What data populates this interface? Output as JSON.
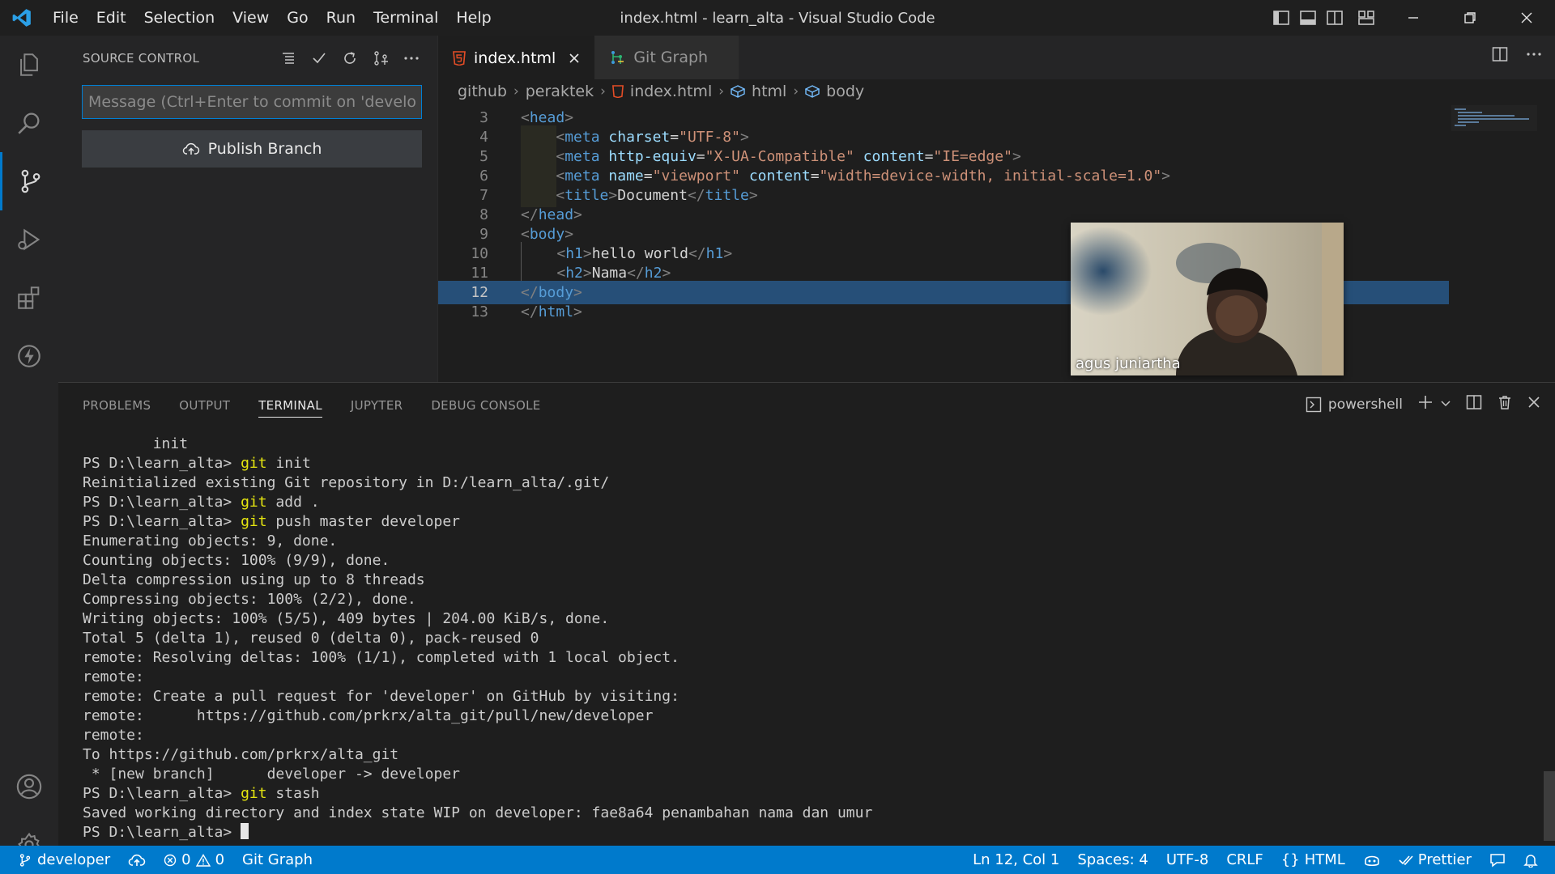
{
  "titlebar": {
    "menu": [
      "File",
      "Edit",
      "Selection",
      "View",
      "Go",
      "Run",
      "Terminal",
      "Help"
    ],
    "title": "index.html - learn_alta - Visual Studio Code"
  },
  "sidebar": {
    "title": "SOURCE CONTROL",
    "message_placeholder": "Message (Ctrl+Enter to commit on 'developer')",
    "publish_label": "Publish Branch"
  },
  "tabs": [
    {
      "label": "index.html",
      "active": true
    },
    {
      "label": "Git Graph",
      "active": false
    }
  ],
  "breadcrumb": [
    "github",
    "peraktek",
    "index.html",
    "html",
    "body"
  ],
  "code_lines": [
    {
      "n": "3"
    },
    {
      "n": "4"
    },
    {
      "n": "5"
    },
    {
      "n": "6"
    },
    {
      "n": "7"
    },
    {
      "n": "8"
    },
    {
      "n": "9"
    },
    {
      "n": "10"
    },
    {
      "n": "11"
    },
    {
      "n": "12"
    },
    {
      "n": "13"
    }
  ],
  "code_text": {
    "charset": "\"UTF-8\"",
    "httpequiv_val": "\"X-UA-Compatible\"",
    "content_edge": "\"IE=edge\"",
    "viewport_name": "\"viewport\"",
    "viewport_content": "\"width=device-width, initial-scale=1.0\"",
    "title_text": "Document",
    "h1_text": "hello world",
    "h2_text": "Nama"
  },
  "webcam": {
    "name": "agus juniartha"
  },
  "panel": {
    "tabs": [
      "PROBLEMS",
      "OUTPUT",
      "TERMINAL",
      "JUPYTER",
      "DEBUG CONSOLE"
    ],
    "active_tab": "TERMINAL",
    "shell": "powershell"
  },
  "terminal": {
    "prompt": "PS D:\\learn_alta> ",
    "lines": [
      {
        "text": "        init"
      },
      {
        "prompt": "PS D:\\learn_alta> ",
        "cmd": "git",
        "args": " init"
      },
      {
        "text": "Reinitialized existing Git repository in D:/learn_alta/.git/"
      },
      {
        "prompt": "PS D:\\learn_alta> ",
        "cmd": "git",
        "args": " add ."
      },
      {
        "prompt": "PS D:\\learn_alta> ",
        "cmd": "git",
        "args": " push master developer"
      },
      {
        "text": "Enumerating objects: 9, done."
      },
      {
        "text": "Counting objects: 100% (9/9), done."
      },
      {
        "text": "Delta compression using up to 8 threads"
      },
      {
        "text": "Compressing objects: 100% (2/2), done."
      },
      {
        "text": "Writing objects: 100% (5/5), 409 bytes | 204.00 KiB/s, done."
      },
      {
        "text": "Total 5 (delta 1), reused 0 (delta 0), pack-reused 0"
      },
      {
        "text": "remote: Resolving deltas: 100% (1/1), completed with 1 local object."
      },
      {
        "text": "remote:"
      },
      {
        "text": "remote: Create a pull request for 'developer' on GitHub by visiting:"
      },
      {
        "text": "remote:      https://github.com/prkrx/alta_git/pull/new/developer"
      },
      {
        "text": "remote:"
      },
      {
        "text": "To https://github.com/prkrx/alta_git"
      },
      {
        "text": " * [new branch]      developer -> developer"
      },
      {
        "prompt": "PS D:\\learn_alta> ",
        "cmd": "git",
        "args": " stash"
      },
      {
        "text": "Saved working directory and index state WIP on developer: fae8a64 penambahan nama dan umur"
      }
    ]
  },
  "statusbar": {
    "branch": "developer",
    "errors": "0",
    "warnings": "0",
    "git_graph": "Git Graph",
    "position": "Ln 12, Col 1",
    "spaces": "Spaces: 4",
    "encoding": "UTF-8",
    "eol": "CRLF",
    "language": "HTML",
    "prettier": "Prettier"
  },
  "colors": {
    "accent": "#007acc",
    "selection": "#264f78",
    "html_icon": "#e44d26"
  }
}
